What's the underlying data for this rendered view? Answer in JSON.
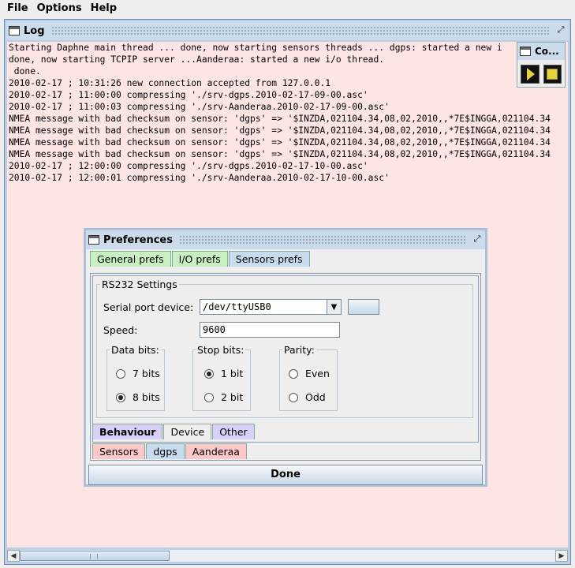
{
  "menubar": {
    "items": [
      "File",
      "Options",
      "Help"
    ]
  },
  "log_window": {
    "title": "Log",
    "lines": [
      "Starting Daphne main thread ... done, now starting sensors threads ... dgps: started a new i",
      "done, now starting TCPIP server ...Aanderaa: started a new i/o thread.",
      " done.",
      "2010-02-17 ; 10:31:26 new connection accepted from 127.0.0.1",
      "2010-02-17 ; 11:00:00 compressing './srv-dgps.2010-02-17-09-00.asc'",
      "2010-02-17 ; 11:00:03 compressing './srv-Aanderaa.2010-02-17-09-00.asc'",
      "NMEA message with bad checksum on sensor: 'dgps' => '$INZDA,021104.34,08,02,2010,,*7E$INGGA,021104.34",
      "NMEA message with bad checksum on sensor: 'dgps' => '$INZDA,021104.34,08,02,2010,,*7E$INGGA,021104.34",
      "NMEA message with bad checksum on sensor: 'dgps' => '$INZDA,021104.34,08,02,2010,,*7E$INGGA,021104.34",
      "NMEA message with bad checksum on sensor: 'dgps' => '$INZDA,021104.34,08,02,2010,,*7E$INGGA,021104.34",
      "2010-02-17 ; 12:00:00 compressing './srv-dgps.2010-02-17-10-00.asc'",
      "2010-02-17 ; 12:00:01 compressing './srv-Aanderaa.2010-02-17-10-00.asc'"
    ],
    "background_color": "#ffe4e4"
  },
  "control_window": {
    "title": "Co...",
    "play_icon": "play-icon",
    "stop_icon": "stop-icon"
  },
  "preferences": {
    "title": "Preferences",
    "top_tabs": [
      "General prefs",
      "I/O prefs",
      "Sensors prefs"
    ],
    "rs232_legend": "RS232 Settings",
    "serial_label": "Serial port device:",
    "serial_value": "/dev/ttyUSB0",
    "speed_label": "Speed:",
    "speed_value": "9600",
    "data_bits": {
      "legend": "Data bits:",
      "options": [
        "7 bits",
        "8 bits"
      ],
      "selected": "8 bits"
    },
    "stop_bits": {
      "legend": "Stop bits:",
      "options": [
        "1 bit",
        "2 bit"
      ],
      "selected": "1 bit"
    },
    "parity": {
      "legend": "Parity:",
      "options": [
        "Even",
        "Odd"
      ],
      "selected": "none"
    },
    "inner_tabs": [
      "Behaviour",
      "Device",
      "Other"
    ],
    "sensor_tabs": [
      "Sensors",
      "dgps",
      "Aanderaa"
    ],
    "done_label": "Done"
  }
}
